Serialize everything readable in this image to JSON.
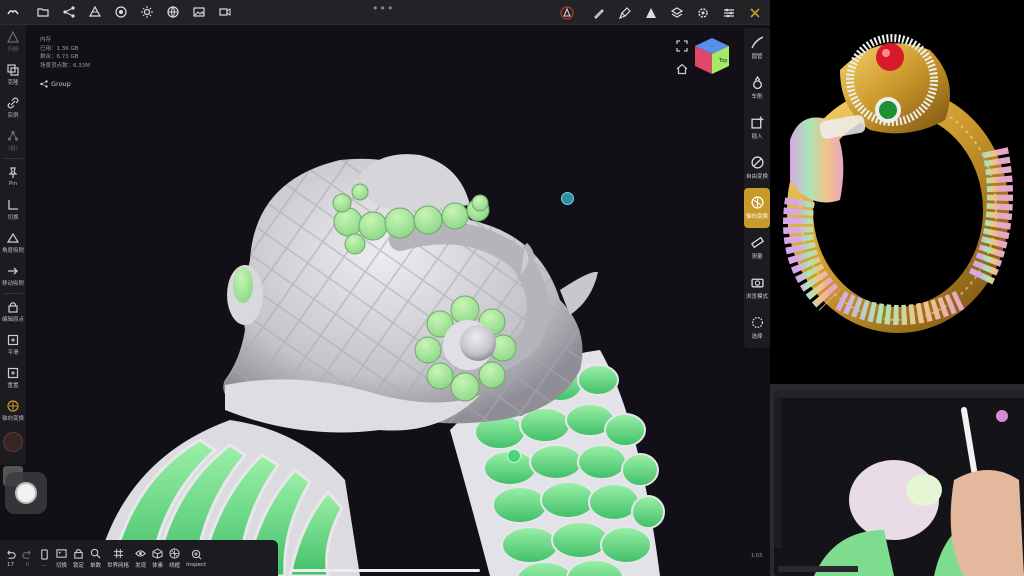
{
  "info": {
    "title": "内存",
    "used": "已用：1.36 GB",
    "free": "剩余：6.73 GB",
    "vertices": "场景顶点数：6.33M"
  },
  "group_label": "Group",
  "cube_label": "Top",
  "left_tools": [
    {
      "label": "归档",
      "icon": "sculpt-icon",
      "dim": true
    },
    {
      "label": "克隆",
      "icon": "clone-icon"
    },
    {
      "label": "实例",
      "icon": "link-icon"
    },
    {
      "label": "(拾)",
      "icon": "nodes-icon",
      "dim": true
    },
    {
      "label": "Pin",
      "icon": "pin-icon"
    },
    {
      "label": "切换",
      "icon": "corner-icon"
    },
    {
      "label": "角度吸附",
      "icon": "angle-icon"
    },
    {
      "label": "移动吸附",
      "icon": "arrow-right-icon"
    },
    {
      "label": "编辑原点",
      "icon": "lock-icon"
    },
    {
      "label": "平滑",
      "icon": "box-icon"
    },
    {
      "label": "重置",
      "icon": "box-icon"
    },
    {
      "label": "轴向变换",
      "icon": "gizmo-icon"
    }
  ],
  "right_tools": [
    {
      "label": "圆管",
      "icon": "pen-curve-icon"
    },
    {
      "label": "车削",
      "icon": "lathe-icon"
    },
    {
      "label": "插入",
      "icon": "insert-icon"
    },
    {
      "label": "自由变换",
      "icon": "free-transform-icon"
    },
    {
      "label": "轴向变换",
      "icon": "axis-transform-icon",
      "active": true
    },
    {
      "label": "测量",
      "icon": "ruler-icon"
    },
    {
      "label": "浏览模式",
      "icon": "camera-icon"
    },
    {
      "label": "选择",
      "icon": "select-icon"
    }
  ],
  "bottom_tools": [
    {
      "label": "17",
      "icon": "undo-icon"
    },
    {
      "label": "0",
      "icon": "redo-icon",
      "dim": true
    },
    {
      "label": "...",
      "icon": "phone-icon"
    },
    {
      "label": "切换",
      "icon": "image-icon"
    },
    {
      "label": "锁定",
      "icon": "lock-icon"
    },
    {
      "label": "单数",
      "icon": "search-icon"
    },
    {
      "label": "世界网格",
      "icon": "grid-icon"
    },
    {
      "label": "发现",
      "icon": "eye-icon"
    },
    {
      "label": "体素",
      "icon": "voxel-icon"
    },
    {
      "label": "线框",
      "icon": "wireframe-icon"
    },
    {
      "label": "Inspect",
      "icon": "inspect-icon"
    }
  ],
  "camera_time": "1:03",
  "colors": {
    "accent": "#c79a2a",
    "model_gray": "#cfcdd3",
    "model_green": "#8fe39a",
    "scale_green": "#6fe08a"
  }
}
